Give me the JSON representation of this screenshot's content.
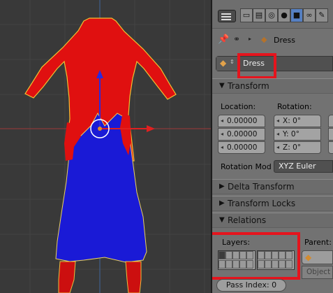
{
  "properties": {
    "context_object": "Dress",
    "object_name": "Dress",
    "transform": {
      "header": "Transform",
      "location_label": "Location:",
      "rotation_label": "Rotation:",
      "location_values": [
        "0.00000",
        "0.00000",
        "0.00000"
      ],
      "rotation_values": [
        "X: 0°",
        "Y: 0°",
        "Z: 0°"
      ],
      "rotation_mode_label": "Rotation Mod",
      "rotation_mode_value": "XYZ Euler"
    },
    "panels": {
      "delta_transform": "Delta Transform",
      "transform_locks": "Transform Locks",
      "relations": "Relations"
    },
    "relations": {
      "layers_label": "Layers:",
      "parent_label": "Parent:",
      "parent_type": "Object",
      "pass_index": "Pass Index: 0"
    }
  },
  "icons": [
    "editor-type-icon",
    "render-icon",
    "scene-icon",
    "world-icon",
    "object-icon",
    "constraints-icon",
    "pin-icon",
    "object-cube-icon",
    "collapse-triangle-icon"
  ],
  "colors": {
    "dress_red": "#e01010",
    "dress_blue": "#1a1ad6",
    "selected_tab": "#5680c2",
    "highlight_box": "#e5141d"
  }
}
